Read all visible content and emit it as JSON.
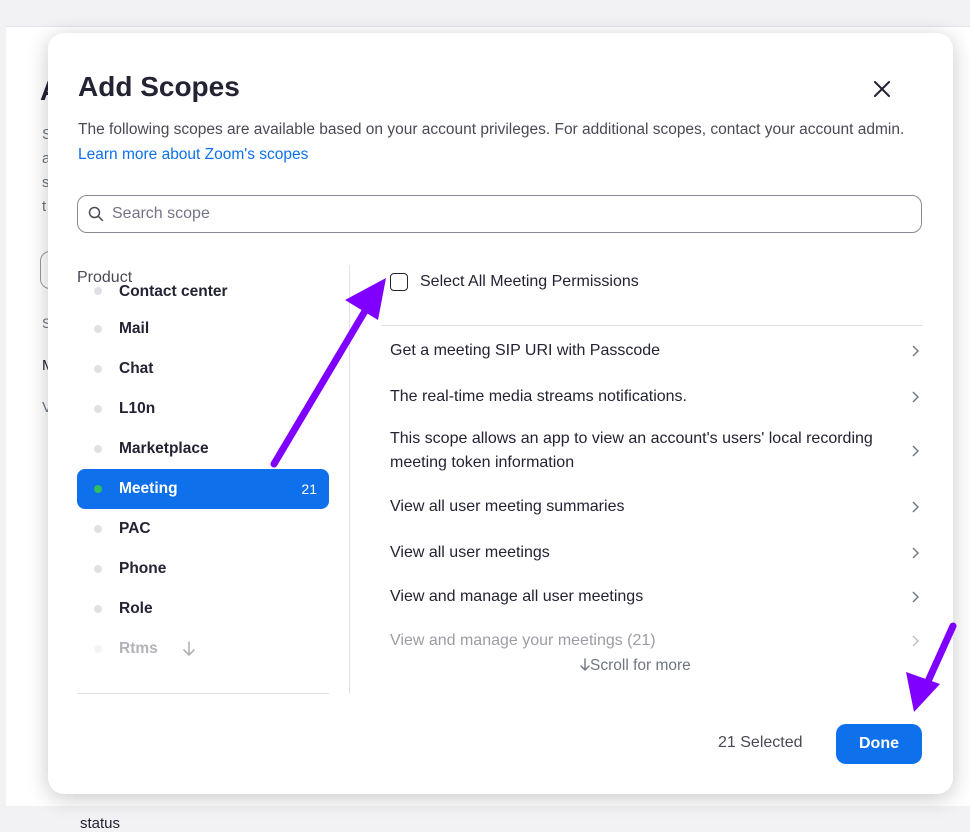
{
  "background": {
    "title_fragment": "A",
    "desc_fragments": [
      "S",
      "a",
      "s",
      "t"
    ],
    "section_label_fragment": "S",
    "row_fragment_1": "M",
    "row_fragment_2": "V",
    "status_text": "status"
  },
  "modal": {
    "title": "Add Scopes",
    "description": "The following scopes are available based on your account privileges. For additional scopes, contact your account admin.",
    "learn_more_link": "Learn more about Zoom's scopes",
    "close_icon": "close-icon"
  },
  "search": {
    "placeholder": "Search scope",
    "value": "",
    "icon": "search-icon"
  },
  "products": {
    "heading": "Product",
    "items": [
      {
        "label": "Contact center",
        "count": ""
      },
      {
        "label": "Mail",
        "count": ""
      },
      {
        "label": "Chat",
        "count": ""
      },
      {
        "label": "L10n",
        "count": ""
      },
      {
        "label": "Marketplace",
        "count": ""
      },
      {
        "label": "Meeting",
        "count": "21",
        "active": true
      },
      {
        "label": "PAC",
        "count": ""
      },
      {
        "label": "Phone",
        "count": ""
      },
      {
        "label": "Role",
        "count": ""
      },
      {
        "label": "Rtms",
        "count": ""
      }
    ],
    "scroll_icon": "arrow-down-icon",
    "active_color": "#0e71eb",
    "active_dot_color": "#2ebe60"
  },
  "scopes": {
    "select_all_label": "Select All Meeting Permissions",
    "select_all_checked": false,
    "items": [
      "Get a meeting SIP URI with Passcode",
      "The real-time media streams notifications.",
      "This scope allows an app to view an account's users' local recording meeting token information",
      "View all user meeting summaries",
      "View all user meetings",
      "View and manage all user meetings",
      "View and manage your meetings (21)"
    ],
    "scroll_hint": "Scroll for more"
  },
  "footer": {
    "selected_text": "21 Selected",
    "done_label": "Done"
  },
  "annotation": {
    "arrow_color": "#7f00ff"
  }
}
